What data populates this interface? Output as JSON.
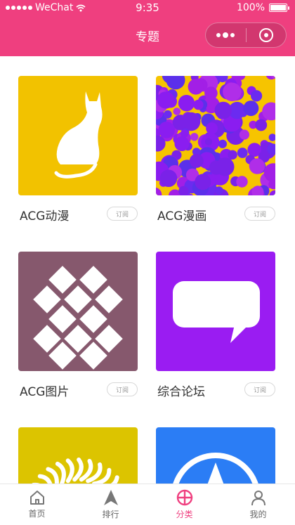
{
  "status_bar": {
    "carrier": "WeChat",
    "time": "9:35",
    "battery": "100%"
  },
  "nav": {
    "title": "专题"
  },
  "cards": [
    {
      "label": "ACG动漫",
      "button": "订阅",
      "bg": "#f2c200",
      "icon": "cat-icon"
    },
    {
      "label": "ACG漫画",
      "button": "订阅",
      "bg": "#8a1df0",
      "icon": "bubbles-pattern"
    },
    {
      "label": "ACG图片",
      "button": "订阅",
      "bg": "#86586d",
      "icon": "diamond-pattern-icon"
    },
    {
      "label": "综合论坛",
      "button": "订阅",
      "bg": "#9a1cf2",
      "icon": "speech-bubble-icon"
    },
    {
      "label": "",
      "button": "",
      "bg": "#dcc400",
      "icon": "sun-icon"
    },
    {
      "label": "",
      "button": "",
      "bg": "#2b7df5",
      "icon": "compass-icon"
    }
  ],
  "tabbar": {
    "items": [
      {
        "label": "首页",
        "icon": "home-icon"
      },
      {
        "label": "排行",
        "icon": "navigation-arrow-icon"
      },
      {
        "label": "分类",
        "icon": "category-icon",
        "active": true
      },
      {
        "label": "我的",
        "icon": "user-icon"
      }
    ],
    "active_color": "#ef3f7f"
  },
  "colors": {
    "header": "#ef3f7f"
  }
}
